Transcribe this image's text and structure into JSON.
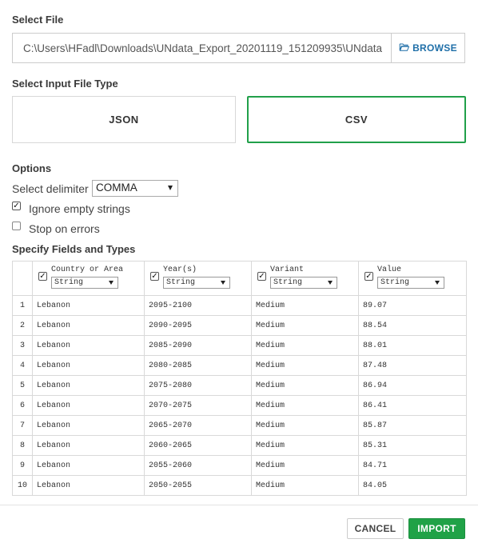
{
  "select_file": {
    "title": "Select File",
    "path_value": "C:\\Users\\HFadl\\Downloads\\UNdata_Export_20201119_151209935\\UNdata",
    "browse_label": "BROWSE",
    "browse_icon": "folder-open-icon"
  },
  "file_type": {
    "title": "Select Input File Type",
    "options": [
      "JSON",
      "CSV"
    ],
    "selected": "CSV"
  },
  "options": {
    "title": "Options",
    "delimiter_label": "Select delimiter",
    "delimiter_value": "COMMA",
    "ignore_empty_label": "Ignore empty strings",
    "ignore_empty_checked": true,
    "stop_on_errors_label": "Stop on errors",
    "stop_on_errors_checked": false
  },
  "fields": {
    "title": "Specify Fields and Types",
    "columns": [
      {
        "name": "Country or Area",
        "type": "String",
        "checked": true
      },
      {
        "name": "Year(s)",
        "type": "String",
        "checked": true
      },
      {
        "name": "Variant",
        "type": "String",
        "checked": true
      },
      {
        "name": "Value",
        "type": "String",
        "checked": true
      }
    ],
    "rows": [
      [
        "1",
        "Lebanon",
        "2095-2100",
        "Medium",
        "89.07"
      ],
      [
        "2",
        "Lebanon",
        "2090-2095",
        "Medium",
        "88.54"
      ],
      [
        "3",
        "Lebanon",
        "2085-2090",
        "Medium",
        "88.01"
      ],
      [
        "4",
        "Lebanon",
        "2080-2085",
        "Medium",
        "87.48"
      ],
      [
        "5",
        "Lebanon",
        "2075-2080",
        "Medium",
        "86.94"
      ],
      [
        "6",
        "Lebanon",
        "2070-2075",
        "Medium",
        "86.41"
      ],
      [
        "7",
        "Lebanon",
        "2065-2070",
        "Medium",
        "85.87"
      ],
      [
        "8",
        "Lebanon",
        "2060-2065",
        "Medium",
        "85.31"
      ],
      [
        "9",
        "Lebanon",
        "2055-2060",
        "Medium",
        "84.71"
      ],
      [
        "10",
        "Lebanon",
        "2050-2055",
        "Medium",
        "84.05"
      ]
    ]
  },
  "footer": {
    "cancel_label": "CANCEL",
    "import_label": "IMPORT"
  },
  "colors": {
    "accent_green": "#20a247",
    "link_blue": "#1f6fa8"
  }
}
